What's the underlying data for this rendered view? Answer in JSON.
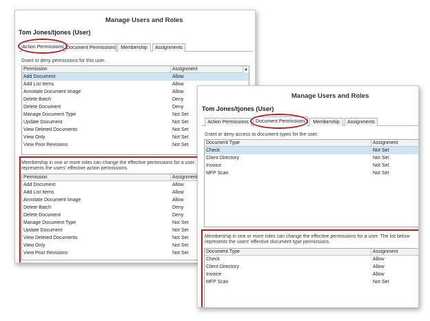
{
  "colors": {
    "accent_red": "#b01e24",
    "selection": "#cde3f6"
  },
  "window1": {
    "title": "Manage Users and Roles",
    "user_heading": "Tom Jones/tjones (User)",
    "tabs": [
      "Action Permissions",
      "Document Permissions",
      "Membership",
      "Assignments"
    ],
    "active_tab": "Action Permissions",
    "grant_text": "Grant or deny permissions for this user.",
    "grid1": {
      "headers": [
        "Permission",
        "Assignment"
      ],
      "rows": [
        [
          "Add Document",
          "Allow"
        ],
        [
          "Add List Items",
          "Allow"
        ],
        [
          "Annotate Document Image",
          "Allow"
        ],
        [
          "Delete Batch",
          "Deny"
        ],
        [
          "Delete Document",
          "Deny"
        ],
        [
          "Manage Document Type",
          "Not Set"
        ],
        [
          "Update Document",
          "Not Set"
        ],
        [
          "View Deleted Documents",
          "Not Set"
        ],
        [
          "View Only",
          "Not Set"
        ],
        [
          "View Prior Revisions",
          "Not Set"
        ]
      ],
      "scroll_up_icon": "▲"
    },
    "membership_text": "Membership in one or more roles can change the effective permissions for a user.  The list below represents the users' effective action permissions.",
    "grid2": {
      "headers": [
        "Permission",
        "Assignment"
      ],
      "rows": [
        [
          "Add Document",
          "Allow"
        ],
        [
          "Add List Items",
          "Allow"
        ],
        [
          "Annotate Document Image",
          "Allow"
        ],
        [
          "Delete Batch",
          "Deny"
        ],
        [
          "Delete Document",
          "Deny"
        ],
        [
          "Manage Document Type",
          "Not Set"
        ],
        [
          "Update Document",
          "Not Set"
        ],
        [
          "View Deleted Documents",
          "Not Set"
        ],
        [
          "View Only",
          "Not Set"
        ],
        [
          "View Prior Revisions",
          "Not Set"
        ]
      ]
    }
  },
  "window2": {
    "title": "Manage Users and Roles",
    "user_heading": "Tom Jones/tjones (User)",
    "tabs": [
      "Action Permissions",
      "Document Permissions",
      "Membership",
      "Assignments"
    ],
    "active_tab": "Document Permissions",
    "grant_text": "Grant or deny access to document types for the user.",
    "grid1": {
      "headers": [
        "Document Type",
        "Assignment"
      ],
      "rows": [
        [
          "Check",
          "Not Set"
        ],
        [
          "Client Directory",
          "Not Set"
        ],
        [
          "Invoice",
          "Not Set"
        ],
        [
          "MFP Scan",
          "Not Set"
        ]
      ]
    },
    "membership_text": "Membership in one or more roles can change the effective permissions for a user.  The list below represents the users' effective document type permissions.",
    "grid2": {
      "headers": [
        "Document Type",
        "Assignment"
      ],
      "rows": [
        [
          "Check",
          "Allow"
        ],
        [
          "Client Directory",
          "Allow"
        ],
        [
          "Invoice",
          "Allow"
        ],
        [
          "MFP Scan",
          "Not Set"
        ]
      ]
    }
  }
}
